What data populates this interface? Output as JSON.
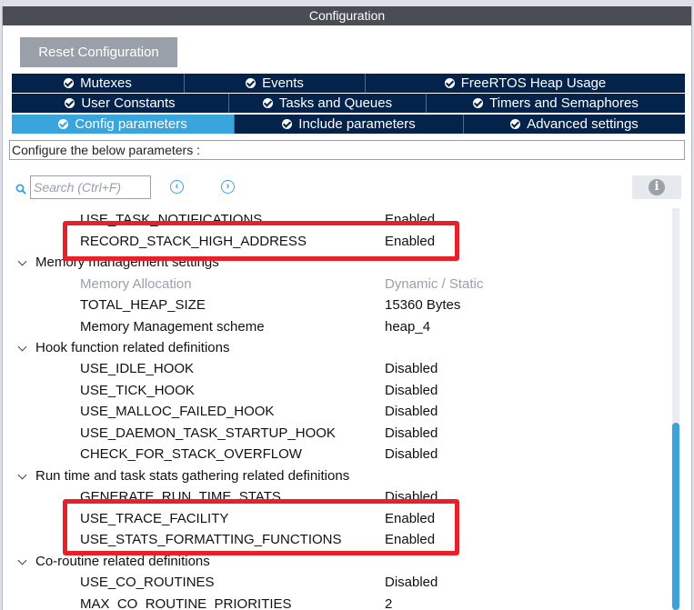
{
  "window": {
    "title": "Configuration"
  },
  "toolbar": {
    "reset_label": "Reset Configuration"
  },
  "tabs": {
    "row1": [
      "Mutexes",
      "Events",
      "FreeRTOS Heap Usage"
    ],
    "row2": [
      "User Constants",
      "Tasks and Queues",
      "Timers and Semaphores"
    ],
    "row3": [
      "Config parameters",
      "Include parameters",
      "Advanced settings"
    ],
    "active": "Config parameters"
  },
  "description": "Configure the below parameters :",
  "search": {
    "placeholder": "Search (Ctrl+F)"
  },
  "tree": {
    "use_task_notifications": {
      "name": "USE_TASK_NOTIFICATIONS",
      "value": "Enabled"
    },
    "record_stack_high_address": {
      "name": "RECORD_STACK_HIGH_ADDRESS",
      "value": "Enabled"
    },
    "memory_group": "Memory management settings",
    "memory_allocation": {
      "name": "Memory Allocation",
      "value": "Dynamic / Static"
    },
    "total_heap_size": {
      "name": "TOTAL_HEAP_SIZE",
      "value": "15360 Bytes"
    },
    "memory_scheme": {
      "name": "Memory Management scheme",
      "value": "heap_4"
    },
    "hook_group": "Hook function related definitions",
    "use_idle_hook": {
      "name": "USE_IDLE_HOOK",
      "value": "Disabled"
    },
    "use_tick_hook": {
      "name": "USE_TICK_HOOK",
      "value": "Disabled"
    },
    "use_malloc_failed_hook": {
      "name": "USE_MALLOC_FAILED_HOOK",
      "value": "Disabled"
    },
    "use_daemon_task_startup_hook": {
      "name": "USE_DAEMON_TASK_STARTUP_HOOK",
      "value": "Disabled"
    },
    "check_for_stack_overflow": {
      "name": "CHECK_FOR_STACK_OVERFLOW",
      "value": "Disabled"
    },
    "runtime_group": "Run time and task stats gathering related definitions",
    "generate_run_time_stats": {
      "name": "GENERATE_RUN_TIME_STATS",
      "value": "Disabled"
    },
    "use_trace_facility": {
      "name": "USE_TRACE_FACILITY",
      "value": "Enabled"
    },
    "use_stats_formatting_functions": {
      "name": "USE_STATS_FORMATTING_FUNCTIONS",
      "value": "Enabled"
    },
    "coroutine_group": "Co-routine related definitions",
    "use_co_routines": {
      "name": "USE_CO_ROUTINES",
      "value": "Disabled"
    },
    "max_co_routine_priorities": {
      "name": "MAX_CO_ROUTINE_PRIORITIES",
      "value": "2"
    }
  },
  "colors": {
    "tab_bg": "#03234b",
    "tab_active": "#39a5dc",
    "highlight": "#e8202a",
    "title_bar": "#4a4d53"
  }
}
